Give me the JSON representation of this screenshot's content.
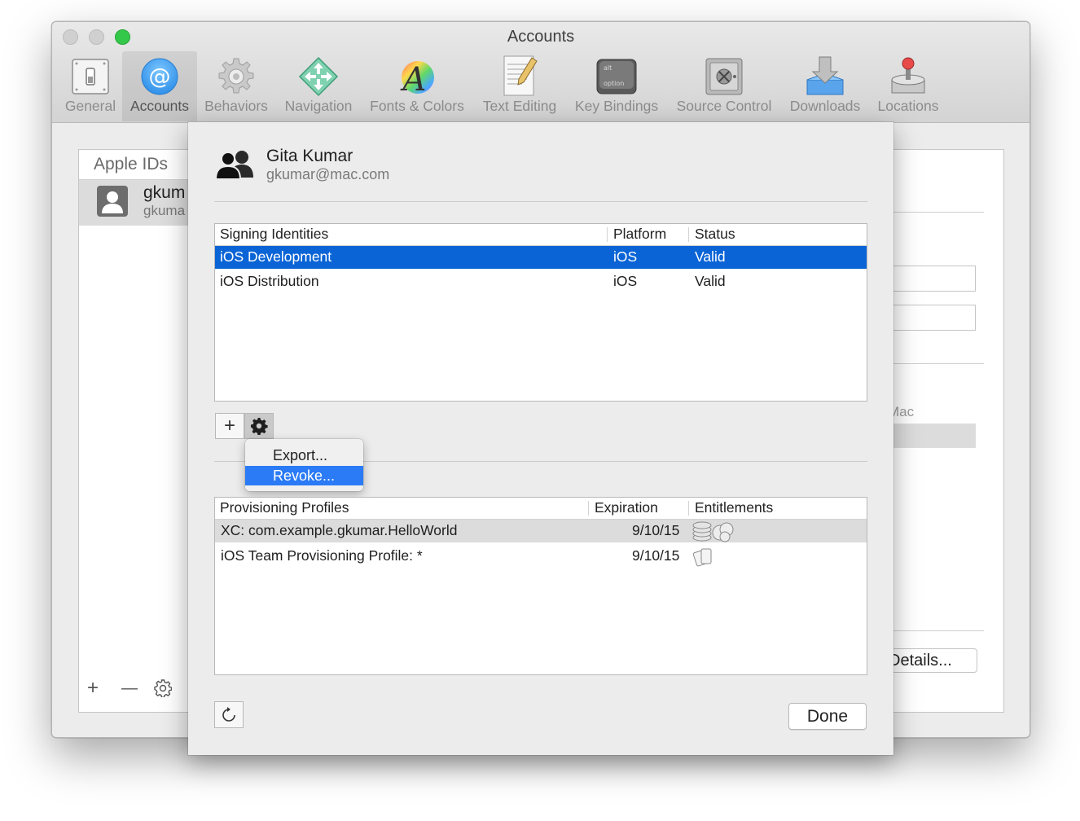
{
  "window": {
    "title": "Accounts"
  },
  "toolbar": {
    "items": [
      {
        "label": "General",
        "icon": "switch-icon"
      },
      {
        "label": "Accounts",
        "icon": "at-sign-icon",
        "selected": true
      },
      {
        "label": "Behaviors",
        "icon": "gear-icon"
      },
      {
        "label": "Navigation",
        "icon": "navigation-arrows-icon"
      },
      {
        "label": "Fonts & Colors",
        "icon": "font-color-icon"
      },
      {
        "label": "Text Editing",
        "icon": "pencil-document-icon"
      },
      {
        "label": "Key Bindings",
        "icon": "keyboard-key-icon"
      },
      {
        "label": "Source Control",
        "icon": "safe-icon"
      },
      {
        "label": "Downloads",
        "icon": "download-box-icon"
      },
      {
        "label": "Locations",
        "icon": "joystick-icon"
      }
    ]
  },
  "apple_ids": {
    "header": "Apple IDs",
    "items": [
      {
        "name": "gkum",
        "email": "gkuma"
      }
    ],
    "controls": {
      "add": "+",
      "remove": "—"
    }
  },
  "detail_panel": {
    "partial_label": "Mac",
    "details_button": "Details..."
  },
  "sheet": {
    "account": {
      "name": "Gita Kumar",
      "email": "gkumar@mac.com"
    },
    "signing_identities": {
      "columns": [
        "Signing Identities",
        "Platform",
        "Status"
      ],
      "rows": [
        {
          "name": "iOS Development",
          "platform": "iOS",
          "status": "Valid",
          "selected": true
        },
        {
          "name": "iOS Distribution",
          "platform": "iOS",
          "status": "Valid"
        }
      ]
    },
    "add_button": "+",
    "context_menu": {
      "items": [
        {
          "label": "Export..."
        },
        {
          "label": "Revoke...",
          "highlighted": true
        }
      ]
    },
    "provisioning_profiles": {
      "columns": [
        "Provisioning Profiles",
        "Expiration",
        "Entitlements"
      ],
      "rows": [
        {
          "name": "XC: com.example.gkumar.HelloWorld",
          "expiration": "9/10/15",
          "entitlements_icon": "database-services-icon"
        },
        {
          "name": "iOS Team Provisioning Profile: *",
          "expiration": "9/10/15",
          "entitlements_icon": "cards-icon"
        }
      ]
    },
    "done_button": "Done"
  },
  "colors": {
    "selection": "#0a64d6",
    "menu_highlight": "#2a7bf5",
    "zoom_green": "#34c84a"
  }
}
